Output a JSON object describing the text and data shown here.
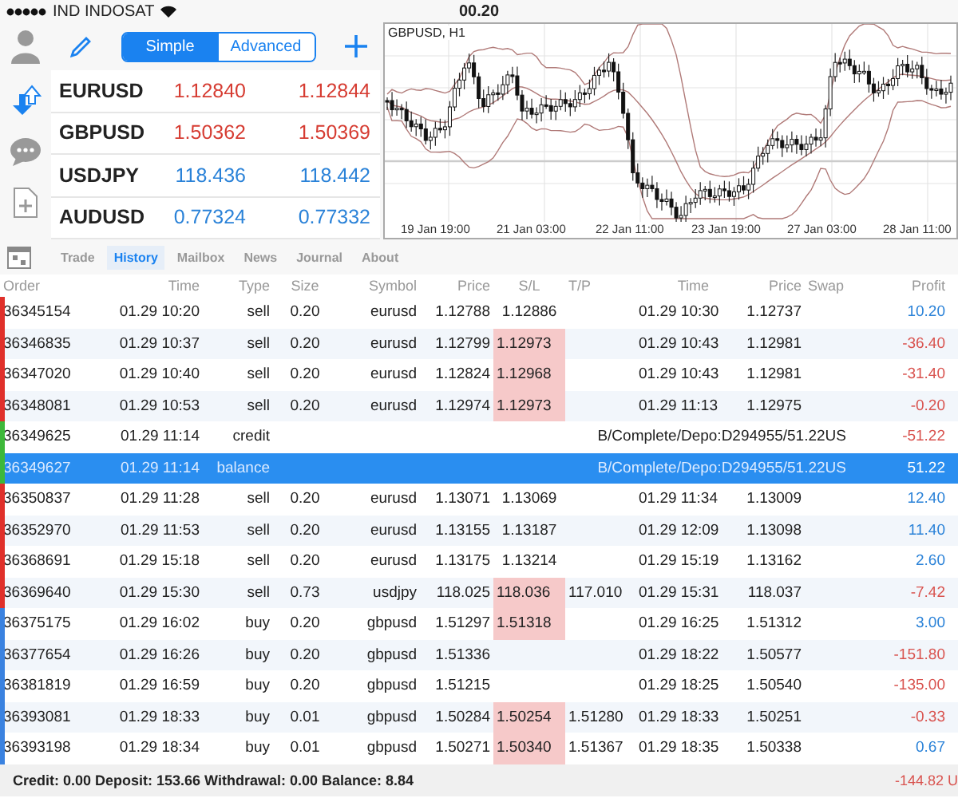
{
  "status_bar": {
    "carrier": "IND INDOSAT",
    "time": "00.20"
  },
  "quotes_panel": {
    "modes": [
      {
        "label": "Simple",
        "selected": true
      },
      {
        "label": "Advanced",
        "selected": false
      }
    ],
    "quotes": [
      {
        "symbol": "EURUSD",
        "bid": "1.12840",
        "ask": "1.12844",
        "color": "#d63c32"
      },
      {
        "symbol": "GBPUSD",
        "bid": "1.50362",
        "ask": "1.50369",
        "color": "#d63c32"
      },
      {
        "symbol": "USDJPY",
        "bid": "118.436",
        "ask": "118.442",
        "color": "#2a82d8"
      },
      {
        "symbol": "AUDUSD",
        "bid": "0.77324",
        "ask": "0.77332",
        "color": "#2a82d8"
      }
    ]
  },
  "chart": {
    "title": "GBPUSD, H1",
    "x_labels": [
      "19 Jan 19:00",
      "21 Jan 03:00",
      "22 Jan 11:00",
      "23 Jan 19:00",
      "27 Jan 03:00",
      "28 Jan 11:00"
    ]
  },
  "tabs": [
    {
      "label": "Trade",
      "selected": false
    },
    {
      "label": "History",
      "selected": true
    },
    {
      "label": "Mailbox",
      "selected": false
    },
    {
      "label": "News",
      "selected": false
    },
    {
      "label": "Journal",
      "selected": false
    },
    {
      "label": "About",
      "selected": false
    }
  ],
  "table": {
    "columns": [
      "Order",
      "Time",
      "Type",
      "Size",
      "Symbol",
      "Price",
      "S/L",
      "T/P",
      "Time",
      "Price",
      "Swap",
      "Profit"
    ],
    "rows": [
      {
        "order": "36345154",
        "time": "01.29 10:20",
        "type": "sell",
        "size": "0.20",
        "symbol": "eurusd",
        "price": "1.12788",
        "sl": "1.12886",
        "sl_hit": false,
        "close_time": "01.29 10:30",
        "close_price": "1.12737",
        "profit": "10.20",
        "loss": false,
        "color": "#e0302a",
        "selected": false
      },
      {
        "order": "36346835",
        "time": "01.29 10:37",
        "type": "sell",
        "size": "0.20",
        "symbol": "eurusd",
        "price": "1.12799",
        "sl": "1.12973",
        "sl_hit": true,
        "close_time": "01.29 10:43",
        "close_price": "1.12981",
        "profit": "-36.40",
        "loss": true,
        "color": "#e0302a",
        "selected": false
      },
      {
        "order": "36347020",
        "time": "01.29 10:40",
        "type": "sell",
        "size": "0.20",
        "symbol": "eurusd",
        "price": "1.12824",
        "sl": "1.12968",
        "sl_hit": true,
        "close_time": "01.29 10:43",
        "close_price": "1.12981",
        "profit": "-31.40",
        "loss": true,
        "color": "#e0302a",
        "selected": false
      },
      {
        "order": "36348081",
        "time": "01.29 10:53",
        "type": "sell",
        "size": "0.20",
        "symbol": "eurusd",
        "price": "1.12974",
        "sl": "1.12973",
        "sl_hit": true,
        "close_time": "01.29 11:13",
        "close_price": "1.12975",
        "profit": "-0.20",
        "loss": true,
        "color": "#e0302a",
        "selected": false
      },
      {
        "order": "36349625",
        "time": "01.29 11:14",
        "type": "credit",
        "comment": "B/Complete/Depo:D294955/51.22US",
        "profit": "-51.22",
        "loss": true,
        "color": "#3db83a",
        "selected": false
      },
      {
        "order": "36349627",
        "time": "01.29 11:14",
        "type": "balance",
        "comment": "B/Complete/Depo:D294955/51.22US",
        "profit": "51.22",
        "loss": false,
        "color": "#3db83a",
        "selected": true
      },
      {
        "order": "36350837",
        "time": "01.29 11:28",
        "type": "sell",
        "size": "0.20",
        "symbol": "eurusd",
        "price": "1.13071",
        "sl": "1.13069",
        "sl_hit": false,
        "close_time": "01.29 11:34",
        "close_price": "1.13009",
        "profit": "12.40",
        "loss": false,
        "color": "#e0302a",
        "selected": false
      },
      {
        "order": "36352970",
        "time": "01.29 11:53",
        "type": "sell",
        "size": "0.20",
        "symbol": "eurusd",
        "price": "1.13155",
        "sl": "1.13187",
        "sl_hit": false,
        "close_time": "01.29 12:09",
        "close_price": "1.13098",
        "profit": "11.40",
        "loss": false,
        "color": "#e0302a",
        "selected": false
      },
      {
        "order": "36368691",
        "time": "01.29 15:18",
        "type": "sell",
        "size": "0.20",
        "symbol": "eurusd",
        "price": "1.13175",
        "sl": "1.13214",
        "sl_hit": false,
        "close_time": "01.29 15:19",
        "close_price": "1.13162",
        "profit": "2.60",
        "loss": false,
        "color": "#e0302a",
        "selected": false
      },
      {
        "order": "36369640",
        "time": "01.29 15:30",
        "type": "sell",
        "size": "0.73",
        "symbol": "usdjpy",
        "price": "118.025",
        "sl": "118.036",
        "sl_hit": true,
        "tp": "117.010",
        "close_time": "01.29 15:31",
        "close_price": "118.037",
        "profit": "-7.42",
        "loss": true,
        "color": "#e0302a",
        "selected": false
      },
      {
        "order": "36375175",
        "time": "01.29 16:02",
        "type": "buy",
        "size": "0.20",
        "symbol": "gbpusd",
        "price": "1.51297",
        "sl": "1.51318",
        "sl_hit": true,
        "close_time": "01.29 16:25",
        "close_price": "1.51312",
        "profit": "3.00",
        "loss": false,
        "color": "#3a82e0",
        "selected": false
      },
      {
        "order": "36377654",
        "time": "01.29 16:26",
        "type": "buy",
        "size": "0.20",
        "symbol": "gbpusd",
        "price": "1.51336",
        "close_time": "01.29 18:22",
        "close_price": "1.50577",
        "profit": "-151.80",
        "loss": true,
        "color": "#3a82e0",
        "selected": false
      },
      {
        "order": "36381819",
        "time": "01.29 16:59",
        "type": "buy",
        "size": "0.20",
        "symbol": "gbpusd",
        "price": "1.51215",
        "close_time": "01.29 18:25",
        "close_price": "1.50540",
        "profit": "-135.00",
        "loss": true,
        "color": "#3a82e0",
        "selected": false
      },
      {
        "order": "36393081",
        "time": "01.29 18:33",
        "type": "buy",
        "size": "0.01",
        "symbol": "gbpusd",
        "price": "1.50284",
        "sl": "1.50254",
        "sl_hit": true,
        "tp": "1.51280",
        "close_time": "01.29 18:33",
        "close_price": "1.50251",
        "profit": "-0.33",
        "loss": true,
        "color": "#3a82e0",
        "selected": false
      },
      {
        "order": "36393198",
        "time": "01.29 18:34",
        "type": "buy",
        "size": "0.01",
        "symbol": "gbpusd",
        "price": "1.50271",
        "sl": "1.50340",
        "sl_hit": true,
        "tp": "1.51367",
        "close_time": "01.29 18:35",
        "close_price": "1.50338",
        "profit": "0.67",
        "loss": false,
        "color": "#3a82e0",
        "selected": false
      }
    ]
  },
  "footer": {
    "summary": "Credit: 0.00 Deposit: 153.66 Withdrawal: 0.00 Balance: 8.84",
    "total": "-144.82 U"
  }
}
